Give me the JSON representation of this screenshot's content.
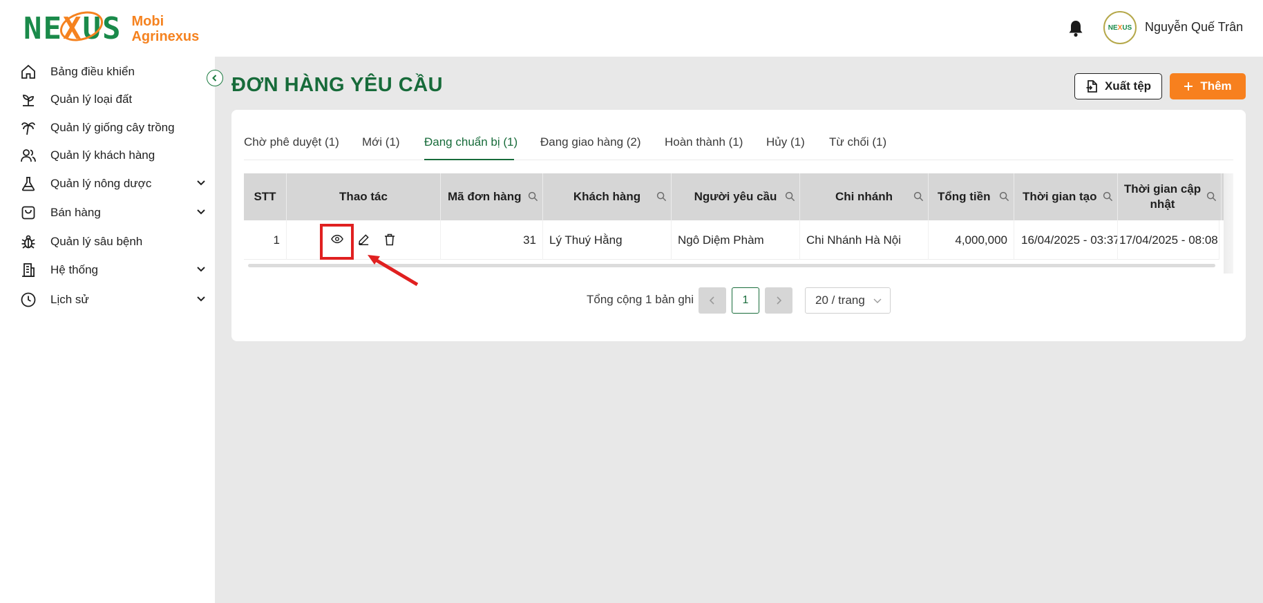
{
  "brand": {
    "logo_mark": "NEXUS",
    "name_line1": "Mobi",
    "name_line2": "Agrinexus",
    "colors": {
      "primary": "#176b3a",
      "accent": "#f7801e"
    }
  },
  "header": {
    "bell_icon": "bell-icon",
    "avatar_text": "NEXUS",
    "user_name": "Nguyễn Quế Trân"
  },
  "sidebar": {
    "items": [
      {
        "label": "Bảng điều khiển",
        "icon": "home-icon",
        "has_children": false
      },
      {
        "label": "Quản lý loại đất",
        "icon": "sprout-icon",
        "has_children": false
      },
      {
        "label": "Quản lý giống cây trồng",
        "icon": "palm-tree-icon",
        "has_children": false
      },
      {
        "label": "Quản lý khách hàng",
        "icon": "users-icon",
        "has_children": false
      },
      {
        "label": "Quản lý nông dược",
        "icon": "flask-icon",
        "has_children": true
      },
      {
        "label": "Bán hàng",
        "icon": "shopping-bag-icon",
        "has_children": true
      },
      {
        "label": "Quản lý sâu bệnh",
        "icon": "bug-icon",
        "has_children": false
      },
      {
        "label": "Hệ thống",
        "icon": "building-icon",
        "has_children": true
      },
      {
        "label": "Lịch sử",
        "icon": "clock-icon",
        "has_children": true
      }
    ]
  },
  "page": {
    "title": "ĐƠN HÀNG YÊU CẦU",
    "export_label": "Xuất tệp",
    "add_label": "Thêm"
  },
  "tabs": [
    {
      "label": "Chờ phê duyệt (1)",
      "active": false
    },
    {
      "label": "Mới (1)",
      "active": false
    },
    {
      "label": "Đang chuẩn bị (1)",
      "active": true
    },
    {
      "label": "Đang giao hàng (2)",
      "active": false
    },
    {
      "label": "Hoàn thành (1)",
      "active": false
    },
    {
      "label": "Hủy (1)",
      "active": false
    },
    {
      "label": "Từ chối (1)",
      "active": false
    }
  ],
  "table": {
    "columns": [
      "STT",
      "Thao tác",
      "Mã đơn hàng",
      "Khách hàng",
      "Người yêu cầu",
      "Chi nhánh",
      "Tổng tiền",
      "Thời gian tạo",
      "Thời gian cập nhật"
    ],
    "rows": [
      {
        "stt": "1",
        "order_id": "31",
        "customer": "Lý Thuý Hằng",
        "requester": "Ngô Diệm Phàm",
        "branch": "Chi Nhánh Hà Nội",
        "total": "4,000,000",
        "created": "16/04/2025 - 03:37",
        "updated": "17/04/2025 - 08:08"
      }
    ]
  },
  "pagination": {
    "total_text": "Tổng cộng 1 bản ghi",
    "current_page": "1",
    "page_size": "20 / trang"
  }
}
